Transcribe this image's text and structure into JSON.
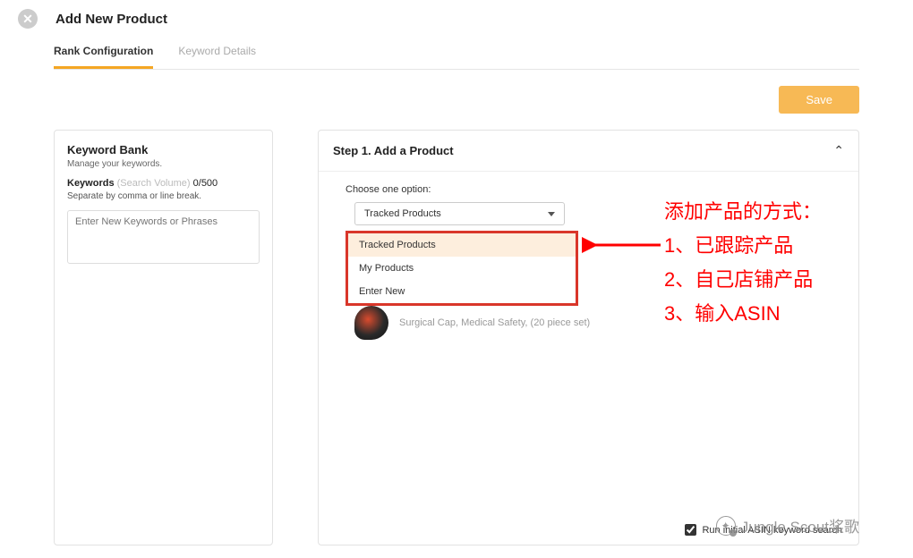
{
  "header": {
    "title": "Add New Product"
  },
  "tabs": [
    {
      "label": "Rank Configuration",
      "active": true
    },
    {
      "label": "Keyword Details",
      "active": false
    }
  ],
  "save_label": "Save",
  "keyword_bank": {
    "title": "Keyword Bank",
    "subtitle": "Manage your keywords.",
    "keywords_label": "Keywords",
    "search_volume_label": "(Search Volume)",
    "count": "0/500",
    "separator_note": "Separate by comma or line break.",
    "placeholder": "Enter New Keywords or Phrases"
  },
  "step": {
    "title": "Step 1. Add a Product",
    "choose_label": "Choose one option:",
    "selected": "Tracked Products",
    "options": [
      "Tracked Products",
      "My Products",
      "Enter New"
    ],
    "product_name": "Surgical Cap, Medical Safety, (20 piece set)",
    "footer_checkbox": "Run initial ASIN keyword search"
  },
  "annotation": {
    "line1": "添加产品的方式：",
    "line2": "1、已跟踪产品",
    "line3": "2、自己店铺产品",
    "line4": "3、输入ASIN"
  },
  "watermark": "Jungle Scout桨歌"
}
